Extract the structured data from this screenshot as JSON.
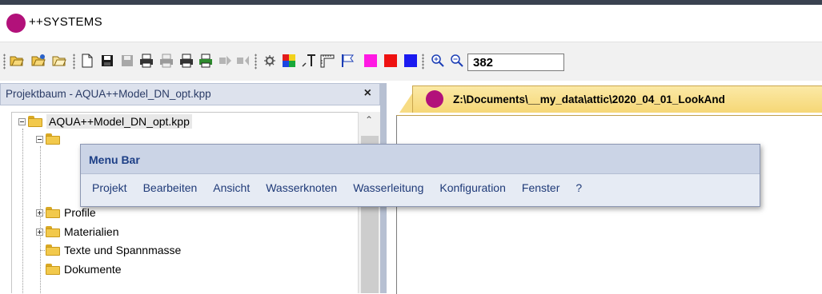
{
  "app": {
    "title": "++SYSTEMS",
    "logo_color": "#b2117a"
  },
  "toolbar": {
    "zoom_value": "382",
    "icons": [
      "open-icon",
      "open-recent-icon",
      "open-folder-icon",
      "new-document-icon",
      "save-icon",
      "save-disabled-icon",
      "print-icon",
      "print-preview-icon",
      "print-setup-icon",
      "print-color-icon",
      "forward-disabled-icon",
      "back-disabled-icon",
      "debug-icon",
      "palette-icon",
      "text-tool-icon",
      "ruler-icon",
      "flag-icon",
      "magenta-swatch-icon",
      "red-swatch-icon",
      "blue-swatch-icon",
      "zoom-in-icon",
      "zoom-out-icon"
    ],
    "swatch_colors": {
      "magenta": "#ff19e3",
      "red": "#ee1111",
      "blue": "#1a1af0"
    }
  },
  "project_panel": {
    "title": "Projektbaum - AQUA++Model_DN_opt.kpp",
    "close_label": "×",
    "tree": [
      {
        "label": "AQUA++Model_DN_opt.kpp"
      },
      {
        "label": "Profile"
      },
      {
        "label": "Materialien"
      },
      {
        "label": "Texte und Spannmasse"
      },
      {
        "label": "Dokumente"
      }
    ]
  },
  "document": {
    "tab_title": "Z:\\Documents\\__my_data\\attic\\2020_04_01_LookAnd"
  },
  "menu_popup": {
    "title": "Menu Bar",
    "items": [
      "Projekt",
      "Bearbeiten",
      "Ansicht",
      "Wasserknoten",
      "Wasserleitung",
      "Konfiguration",
      "Fenster",
      "?"
    ]
  }
}
